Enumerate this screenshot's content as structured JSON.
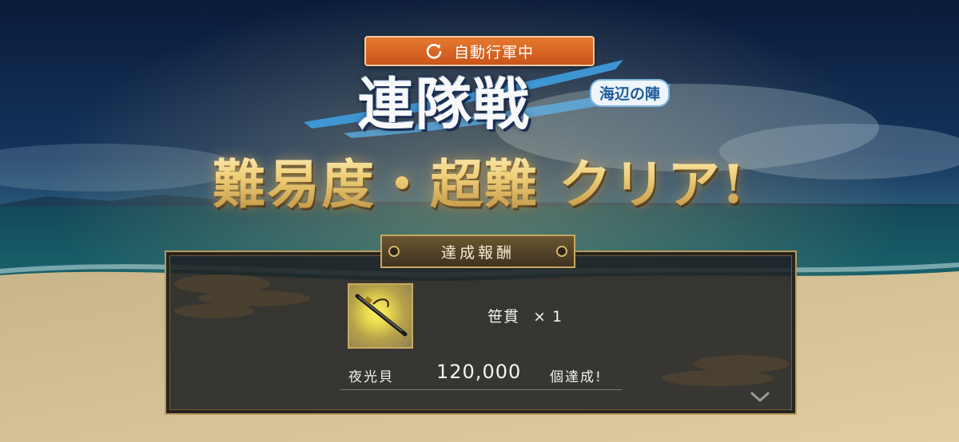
{
  "auto_march": {
    "label": "自動行軍中",
    "icon": "refresh-icon"
  },
  "title": {
    "main": "連隊戦",
    "subtitle": "海辺の陣"
  },
  "clear_message": "難易度・超難 クリア!",
  "reward_panel": {
    "header": "達成報酬",
    "reward": {
      "icon": "katana-icon",
      "name": "笹貫",
      "quantity": "× 1"
    },
    "achievement": {
      "label": "夜光貝",
      "value": "120,000",
      "suffix": "個達成!"
    },
    "more_icon": "chevron-down-icon"
  },
  "colors": {
    "accent": "#d9692a",
    "gold": "#f0cf79",
    "panel_border": "#b99a5c"
  }
}
